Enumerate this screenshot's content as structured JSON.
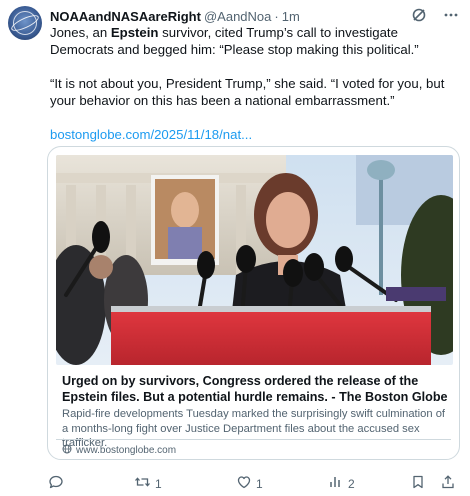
{
  "tweet": {
    "display_name": "NOAAandNASAareRight",
    "handle": "@AandNoa",
    "separator": "·",
    "time": "1m",
    "text_line1_pre": "Jones, an ",
    "text_line1_bold": "Epstein",
    "text_line1_post": " survivor, cited Trump’s call to investigate Democrats and begged him: “Please stop making this political.”",
    "text_line2": "“It is not about you, President Trump,” she said. “I voted for you, but your behavior on this has been a national embarrassment.”",
    "link_text": "bostonglobe.com/2025/11/18/nat..."
  },
  "card": {
    "title": "Urged on by survivors, Congress ordered the release of the Epstein files. But a potential hurdle remains. - The Boston Globe",
    "description": "Rapid-fire developments Tuesday marked the surprisingly swift culmination of a months-long fight over Justice Department files about the accused sex trafficker.",
    "domain": "www.bostonglobe.com"
  },
  "actions": {
    "reply_count": "",
    "repost_count": "1",
    "like_count": "1",
    "views_count": "2"
  },
  "icons": {
    "avatar": "globe-orbit-avatar",
    "grok": "grok-icon",
    "more": "more-icon",
    "reply": "reply-icon",
    "repost": "repost-icon",
    "like": "heart-icon",
    "views": "views-icon",
    "bookmark": "bookmark-icon",
    "share": "share-icon"
  },
  "colors": {
    "text": "#0f1419",
    "secondary": "#536471",
    "link": "#1d9bf0",
    "border": "#cfd9de",
    "podium_red": "#d6323a"
  }
}
